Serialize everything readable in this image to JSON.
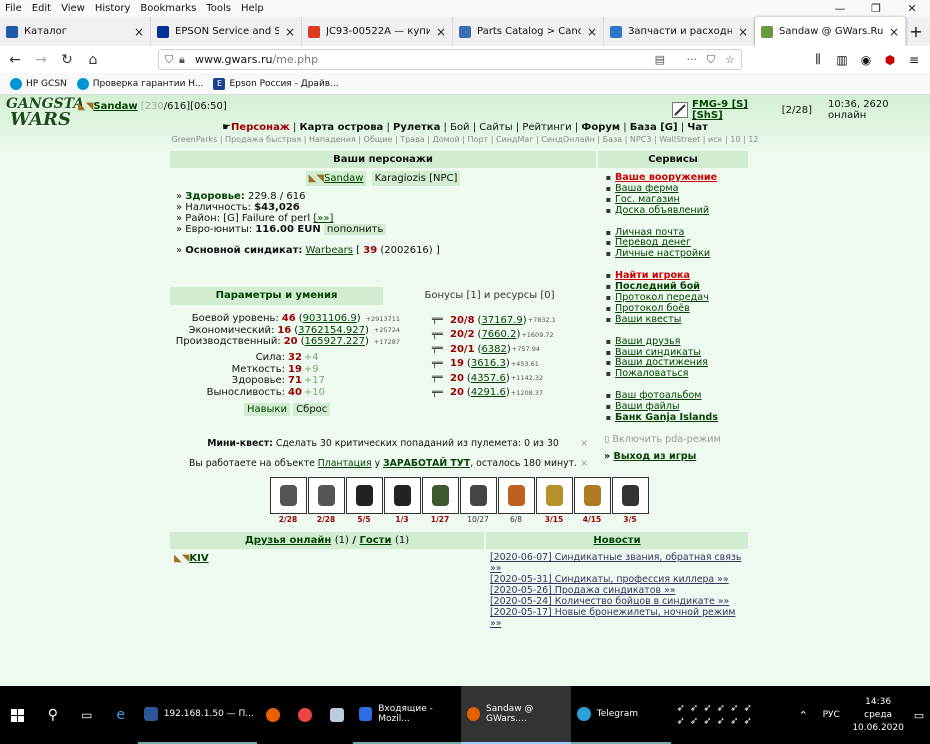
{
  "menu": [
    "File",
    "Edit",
    "View",
    "History",
    "Bookmarks",
    "Tools",
    "Help"
  ],
  "tabs": [
    {
      "title": "Каталог",
      "color": "#1e5ba8"
    },
    {
      "title": "EPSON Service and Support Pag",
      "color": "#003399"
    },
    {
      "title": "JC93-00522A — купите JC9",
      "color": "#e03a1e"
    },
    {
      "title": "Parts Catalog > Canon > i-S",
      "color": "#3a6fb5"
    },
    {
      "title": "Запчасти и расходные мат",
      "color": "#2d78c9"
    },
    {
      "title": "Sandaw @ GWars.Ru",
      "color": "#6a9a40"
    }
  ],
  "url": {
    "host": "www.gwars.ru",
    "path": "/me.php"
  },
  "bookmarks": [
    "HP GCSN",
    "Проверка гарантии H...",
    "Epson Россия - Драйв..."
  ],
  "header": {
    "logo_line1": "GANGSTA",
    "logo_line2": "WARS",
    "user_name": "Sandaw",
    "stats_grey": "[230",
    "stats_rest": "/616][06:50]",
    "weapon": "FMG-9 [S][ShS]",
    "weapon_count": "[2/28]",
    "time_online": "10:36, 2620 онлайн"
  },
  "mainnav": [
    "Персонаж",
    "Карта острова",
    "Рулетка",
    "Бой",
    "Сайты",
    "Рейтинги",
    "Форум",
    "База [G]",
    "Чат"
  ],
  "subnav": "GreenParks | Продажа быстрая | Нападения | Общие | Трава | Домой | Порт | СиндМаг | СиндОнлайн | База | NPC3 | WallStreet | иск | 10 | 12",
  "chars": {
    "title": "Ваши персонажи",
    "char1": "Sandaw",
    "char2": "Karagiozis [NPC]",
    "health_label": "Здоровье:",
    "health_value": "229.8 / 616",
    "cash_label": "Наличность:",
    "cash_value": "$43,026",
    "district_label": "Район:",
    "district_value": "[G] Failure of perl",
    "district_link": "[»»]",
    "euro_label": "Евро-юниты:",
    "euro_value": "116.00 EUN",
    "euro_btn": "пополнить",
    "synd_label": "Основной синдикат:",
    "synd_name": "Warbears",
    "synd_level": "39",
    "synd_extra": "(2002616) ]"
  },
  "services": {
    "title": "Сервисы",
    "groups": [
      [
        {
          "label": "Ваше вооружение",
          "style": "red"
        },
        {
          "label": "Ваша ферма"
        },
        {
          "label": "Гос. магазин"
        },
        {
          "label": "Доска объявлений"
        }
      ],
      [
        {
          "label": "Личная почта"
        },
        {
          "label": "Перевод денег"
        },
        {
          "label": "Личные настройки"
        }
      ],
      [
        {
          "label": "Найти игрока",
          "style": "red"
        },
        {
          "label": "Последний бой",
          "style": "bold"
        },
        {
          "label": "Протокол передач"
        },
        {
          "label": "Протокол боёв"
        },
        {
          "label": "Ваши квесты"
        }
      ],
      [
        {
          "label": "Ваши друзья"
        },
        {
          "label": "Ваши синдикаты"
        },
        {
          "label": "Ваши достижения"
        },
        {
          "label": "Пожаловаться"
        }
      ],
      [
        {
          "label": "Ваш фотоальбом"
        },
        {
          "label": "Ваши файлы"
        },
        {
          "label": "Банк Ganja Islands",
          "style": "bold"
        }
      ]
    ],
    "pda": "Включить pda-режим",
    "exit": "Выход из игры"
  },
  "params": {
    "tab_active": "Параметры и умения",
    "tab_other": "Бонусы [1] и ресурсы [0]",
    "levels": [
      {
        "label": "Боевой уровень:",
        "lvl": "46",
        "exp": "9031106.9",
        "inc": "+2913711"
      },
      {
        "label": "Экономический:",
        "lvl": "16",
        "exp": "3762154.927",
        "inc": "+25724"
      },
      {
        "label": "Производственный:",
        "lvl": "20",
        "exp": "165927.227",
        "inc": "+17287"
      }
    ],
    "attrs": [
      {
        "label": "Сила:",
        "val": "32",
        "bonus": "+4"
      },
      {
        "label": "Меткость:",
        "val": "19",
        "bonus": "+9"
      },
      {
        "label": "Здоровье:",
        "val": "71",
        "bonus": "+17"
      },
      {
        "label": "Выносливость:",
        "val": "40",
        "bonus": "+10"
      }
    ],
    "btn_skills": "Навыки",
    "btn_reset": "Сброс",
    "weapons": [
      {
        "lvl": "20/8",
        "exp": "37167.9",
        "inc": "+7832.1"
      },
      {
        "lvl": "20/2",
        "exp": "7660.2",
        "inc": "+1609.72"
      },
      {
        "lvl": "20/1",
        "exp": "6382",
        "inc": "+757.94"
      },
      {
        "lvl": "19",
        "exp": "3616.3",
        "inc": "+453.61"
      },
      {
        "lvl": "20",
        "exp": "4357.6",
        "inc": "+1142.32"
      },
      {
        "lvl": "20",
        "exp": "4291.6",
        "inc": "+1208.37"
      }
    ]
  },
  "quests": {
    "mini_label": "Мини-квест:",
    "mini_text": "Сделать 30 критических попаданий из пулемета: 0 из 30",
    "work_prefix": "Вы работаете на объекте",
    "work_place": "Плантация",
    "work_mid": "у",
    "work_link": "ЗАРАБОТАЙ ТУТ",
    "work_suffix": ", осталось 180 минут.",
    "close": "×"
  },
  "items": [
    {
      "name": "rifle",
      "count": "2/28",
      "red": true,
      "color": "#555"
    },
    {
      "name": "rifle2",
      "count": "2/28",
      "red": true,
      "color": "#555"
    },
    {
      "name": "helmet",
      "count": "5/5",
      "red": true,
      "color": "#222"
    },
    {
      "name": "vest",
      "count": "1/3",
      "red": true,
      "color": "#222"
    },
    {
      "name": "camo",
      "count": "1/27",
      "red": true,
      "color": "#3c5a32"
    },
    {
      "name": "boots",
      "count": "10/27",
      "red": false,
      "color": "#444"
    },
    {
      "name": "dog",
      "count": "6/8",
      "red": false,
      "color": "#c06020"
    },
    {
      "name": "oscar",
      "count": "3/15",
      "red": true,
      "color": "#b8902a"
    },
    {
      "name": "badge",
      "count": "4/15",
      "red": true,
      "color": "#b07a20"
    },
    {
      "name": "binoculars",
      "count": "3/5",
      "red": true,
      "color": "#333"
    }
  ],
  "friends": {
    "title_link1": "Друзья онлайн",
    "count1": "(1)",
    "sep": "/",
    "title_link2": "Гости",
    "count2": "(1)",
    "friend": "KIV"
  },
  "news": {
    "title": "Новости",
    "items": [
      "[2020-06-07] Синдикатные звания, обратная связь »»",
      "[2020-05-31] Синдикаты, профессия киллера »»",
      "[2020-05-26] Продажа синдикатов »»",
      "[2020-05-24] Количество бойцов в синдикате »»",
      "[2020-05-17] Новые бронежилеты, ночной режим »»"
    ]
  },
  "taskbar": {
    "items": [
      {
        "label": "192.168.1.50 — П...",
        "color": "#2b5797"
      },
      {
        "label": "Входящие - Mozil...",
        "color": "#2d6ee0"
      },
      {
        "label": "Sandaw @ GWars....",
        "color": "#e66000"
      },
      {
        "label": "Telegram",
        "color": "#2aa1da"
      }
    ],
    "lang": "РУС",
    "time": "14:36",
    "day": "среда",
    "date": "10.06.2020"
  }
}
